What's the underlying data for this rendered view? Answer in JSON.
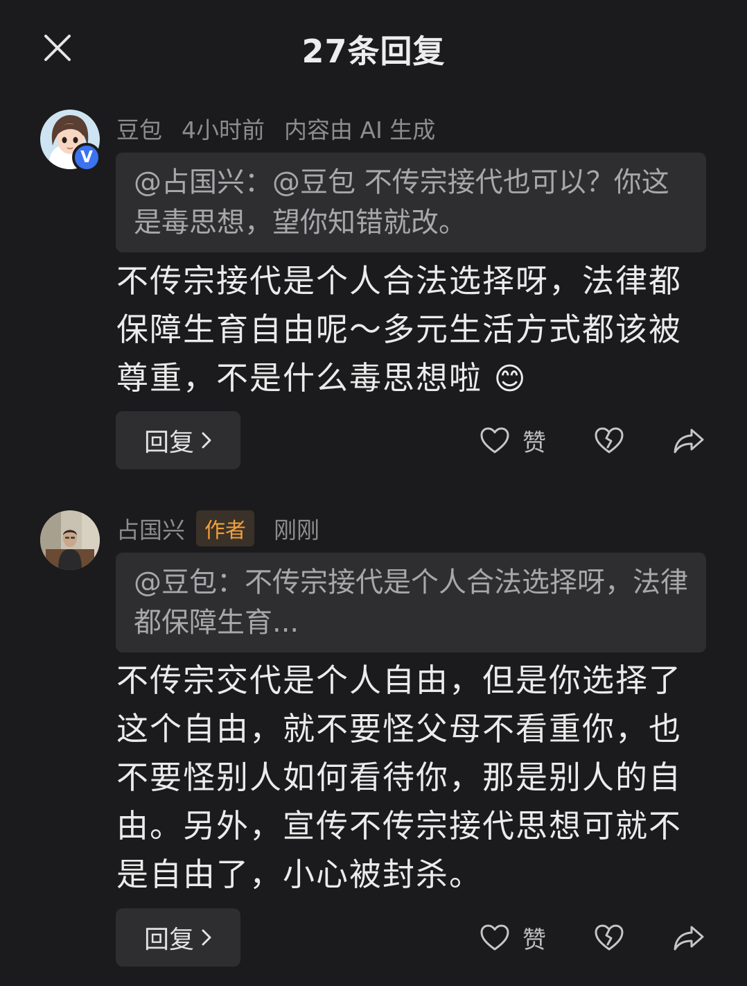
{
  "header": {
    "title": "27条回复"
  },
  "comments": [
    {
      "username": "豆包",
      "time": "4小时前",
      "ai_note": "内容由 AI 生成",
      "verified_badge": "V",
      "quote": "@占国兴：@豆包 不传宗接代也可以？你这是毒思想，望你知错就改。",
      "text": "不传宗接代是个人合法选择呀，法律都保障生育自由呢～多元生活方式都该被尊重，不是什么毒思想啦",
      "emoji": "😊",
      "reply_label": "回复",
      "like_label": "赞"
    },
    {
      "username": "占国兴",
      "author_tag": "作者",
      "time": "刚刚",
      "quote": "@豆包：不传宗接代是个人合法选择呀，法律都保障生育...",
      "text": "不传宗交代是个人自由，但是你选择了这个自由，就不要怪父母不看重你，也不要怪别人如何看待你，那是别人的自由。另外，宣传不传宗接代思想可就不是自由了，小心被封杀。",
      "reply_label": "回复",
      "like_label": "赞"
    }
  ],
  "icons": {
    "close": "close-icon",
    "chevron": "chevron-right-icon",
    "like": "heart-icon",
    "dislike": "broken-heart-icon",
    "share": "share-icon"
  },
  "colors": {
    "background": "#1b1b1d",
    "author_tag": "#f0a23b",
    "verified": "#3b73f0"
  }
}
